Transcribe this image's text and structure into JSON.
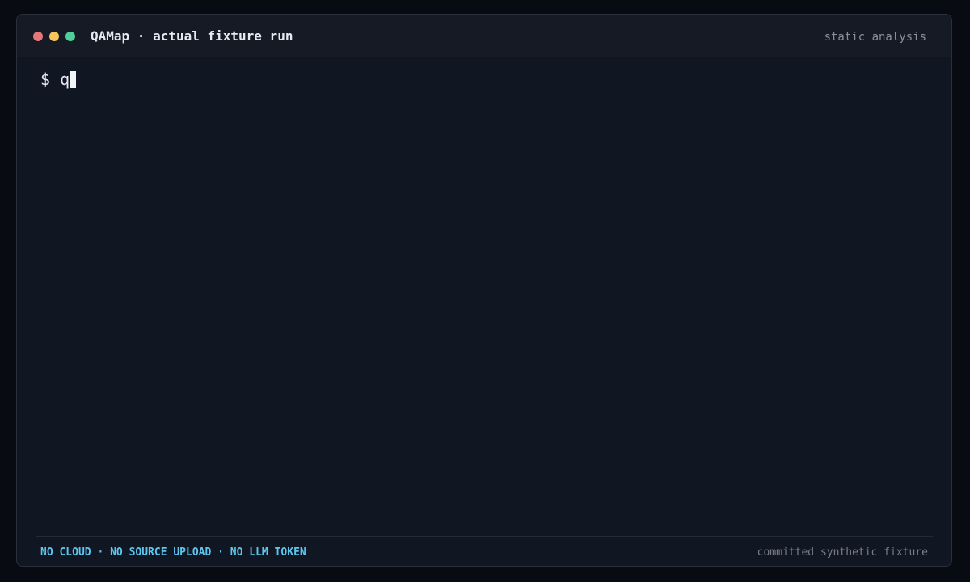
{
  "window": {
    "title": "QAMap · actual fixture run",
    "mode_label": "static analysis",
    "controls": {
      "close_color": "#e5777a",
      "minimize_color": "#f6c65b",
      "maximize_color": "#4fcf9a"
    }
  },
  "terminal": {
    "prompt": "$",
    "input_text": "q"
  },
  "footer": {
    "flags": "NO CLOUD · NO SOURCE UPLOAD · NO LLM TOKEN",
    "note": "committed synthetic fixture"
  },
  "colors": {
    "background": "#080b12",
    "window": "#111623",
    "titlebar": "#151a25",
    "accent": "#5cc6ee",
    "muted": "#8a909b"
  }
}
